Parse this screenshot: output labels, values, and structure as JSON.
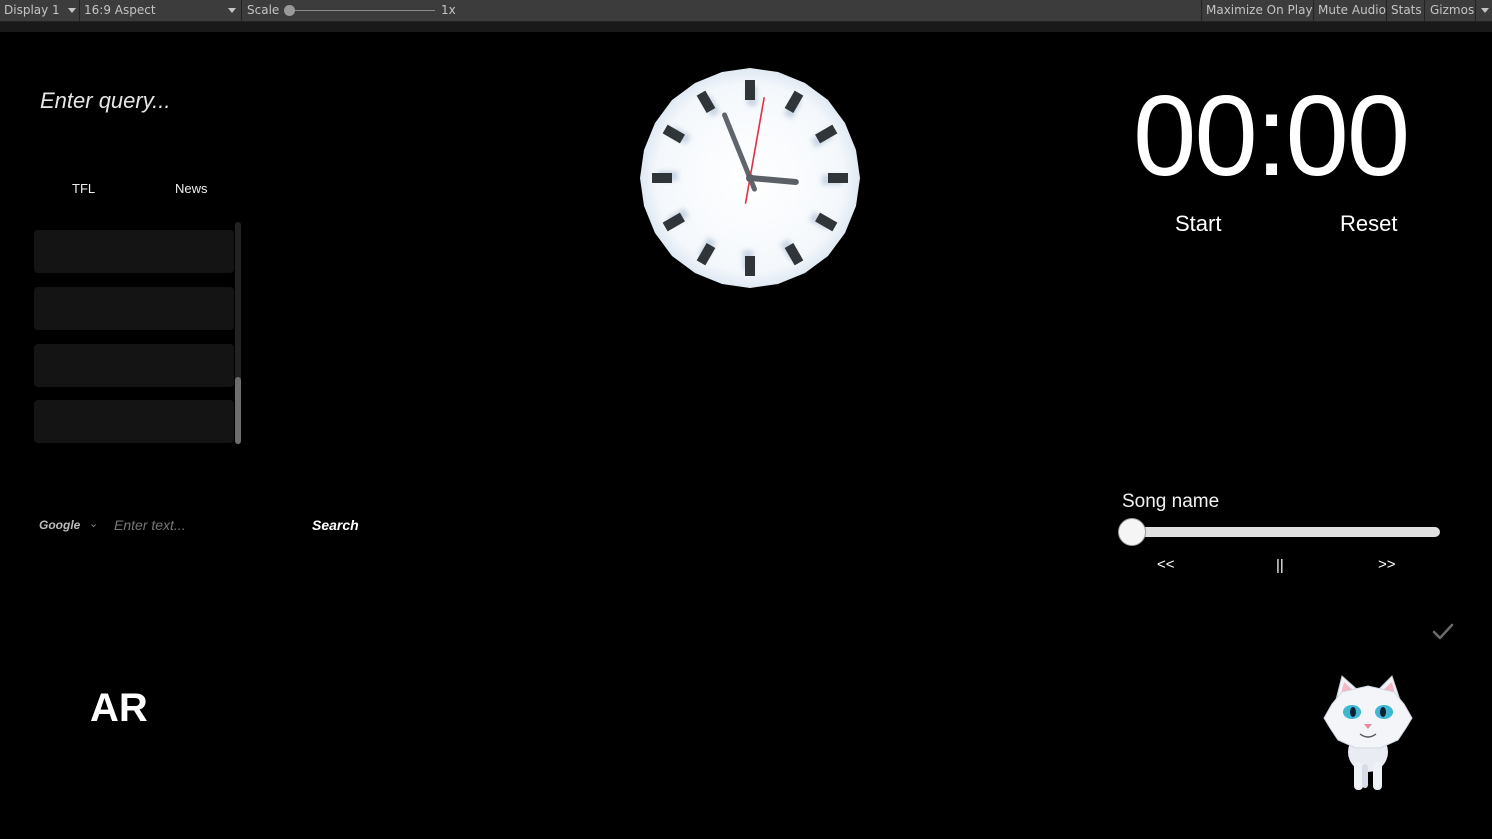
{
  "toolbar": {
    "display": "Display 1",
    "aspect": "16:9 Aspect",
    "scale_label": "Scale",
    "scale_value": "1x",
    "maximize": "Maximize On Play",
    "mute": "Mute Audio",
    "stats": "Stats",
    "gizmos": "Gizmos"
  },
  "query": {
    "placeholder": "Enter query..."
  },
  "tabs": [
    "TFL",
    "News"
  ],
  "list": {
    "item_count": 4
  },
  "search": {
    "engine": "Google",
    "placeholder": "Enter text...",
    "button": "Search"
  },
  "ar_label": "AR",
  "clock": {
    "hour_hand_deg": 95,
    "minute_hand_deg": 338,
    "second_hand_deg": 10,
    "face_color": "#ffffff",
    "marker_color": "#30353a",
    "second_hand_color": "#e03040"
  },
  "timer": {
    "display": "00:00",
    "start": "Start",
    "reset": "Reset"
  },
  "music": {
    "song_name": "Song name",
    "progress": 0,
    "prev": "<<",
    "pause": "||",
    "next": ">>"
  }
}
